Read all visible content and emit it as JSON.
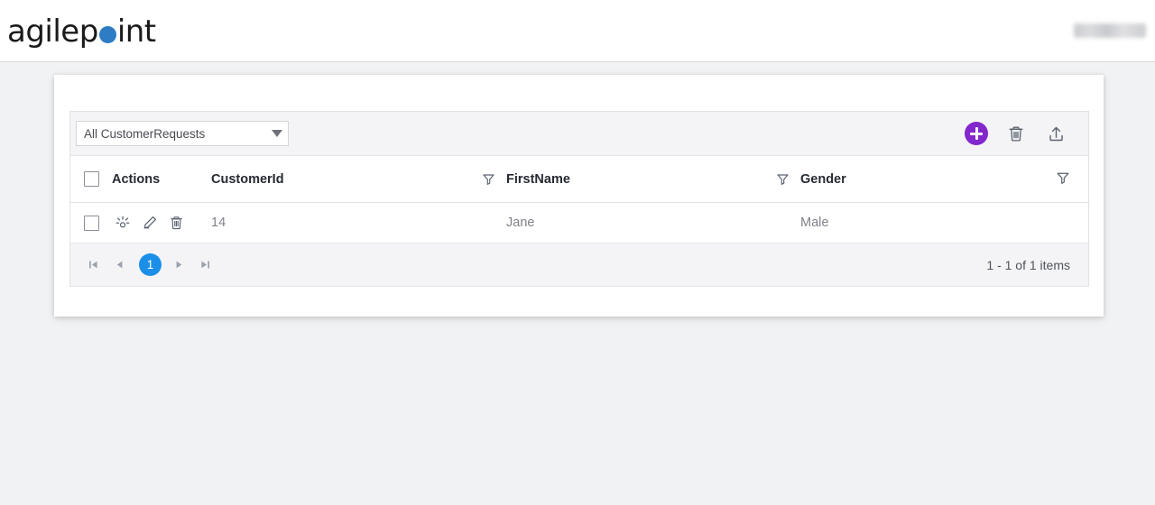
{
  "topbar": {
    "brand": {
      "prefix": "agilep",
      "dot_icon": "circle-dot",
      "suffix": "int",
      "dot_color": "#2d7cc4"
    },
    "user_label": ""
  },
  "grid": {
    "toolbar": {
      "view_selector": {
        "value": "All CustomerRequests",
        "caret_icon": "chevron-down-icon"
      },
      "buttons": [
        {
          "name": "add",
          "icon": "plus-circle-icon",
          "label": "",
          "color": "#8227cb"
        },
        {
          "name": "delete",
          "icon": "trash-icon",
          "label": ""
        },
        {
          "name": "export",
          "icon": "upload-icon",
          "label": ""
        }
      ]
    },
    "columns": [
      {
        "key": "select",
        "label": "",
        "filter": false
      },
      {
        "key": "actions",
        "label": "Actions",
        "filter": false
      },
      {
        "key": "customerid",
        "label": "CustomerId",
        "filter": false
      },
      {
        "key": "firstname",
        "label": "FirstName",
        "filter": true
      },
      {
        "key": "gender",
        "label": "Gender",
        "filter": true
      }
    ],
    "header_filter_icon": "filter-icon",
    "rows": [
      {
        "selected": false,
        "actions": [
          "view-icon",
          "edit-icon",
          "delete-icon"
        ],
        "customerid": "14",
        "firstname": "Jane",
        "gender": "Male"
      }
    ],
    "pager": {
      "first_icon": "page-first-icon",
      "prev_icon": "page-prev-icon",
      "next_icon": "page-next-icon",
      "last_icon": "page-last-icon",
      "current_page": "1",
      "info": "1 - 1 of 1 items",
      "active_color": "#1b8fe8"
    }
  }
}
